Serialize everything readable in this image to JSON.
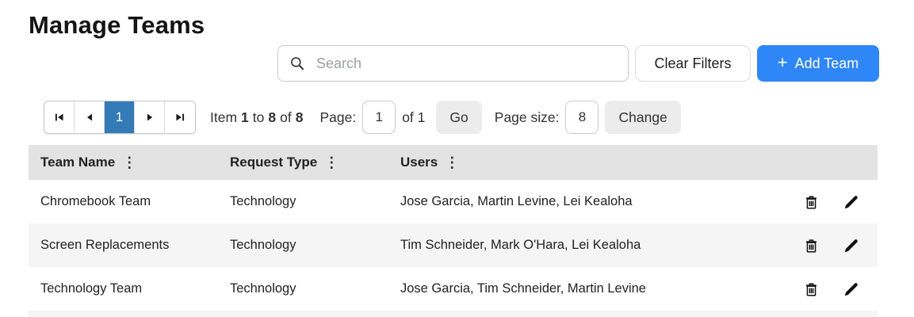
{
  "page": {
    "title": "Manage Teams"
  },
  "toolbar": {
    "search": {
      "placeholder": "Search",
      "value": ""
    },
    "clear_filters_label": "Clear Filters",
    "add_team_label": "Add Team",
    "add_team_plus": "+"
  },
  "pagination": {
    "active_page": "1",
    "summary": {
      "item_word": "Item",
      "from": "1",
      "to_word": "to",
      "to": "8",
      "of_word": "of",
      "total": "8"
    },
    "page_label": "Page:",
    "page_input_value": "1",
    "of_text": "of 1",
    "go_label": "Go",
    "page_size_label": "Page size:",
    "page_size_value": "8",
    "change_label": "Change"
  },
  "icons": {
    "column_menu": "⋮"
  },
  "table": {
    "columns": [
      {
        "label": "Team Name"
      },
      {
        "label": "Request Type"
      },
      {
        "label": "Users"
      }
    ],
    "rows": [
      {
        "team_name": "Chromebook Team",
        "request_type": "Technology",
        "users": "Jose Garcia, Martin Levine, Lei Kealoha"
      },
      {
        "team_name": "Screen Replacements",
        "request_type": "Technology",
        "users": "Tim Schneider, Mark O'Hara, Lei Kealoha"
      },
      {
        "team_name": "Technology Team",
        "request_type": "Technology",
        "users": "Jose Garcia, Tim Schneider, Martin Levine"
      }
    ]
  },
  "colors": {
    "accent_blue": "#2f86f6",
    "pagination_active_blue": "#337ab7",
    "table_header_bg": "#e3e3e3",
    "row_alt_bg": "#f5f5f5"
  }
}
